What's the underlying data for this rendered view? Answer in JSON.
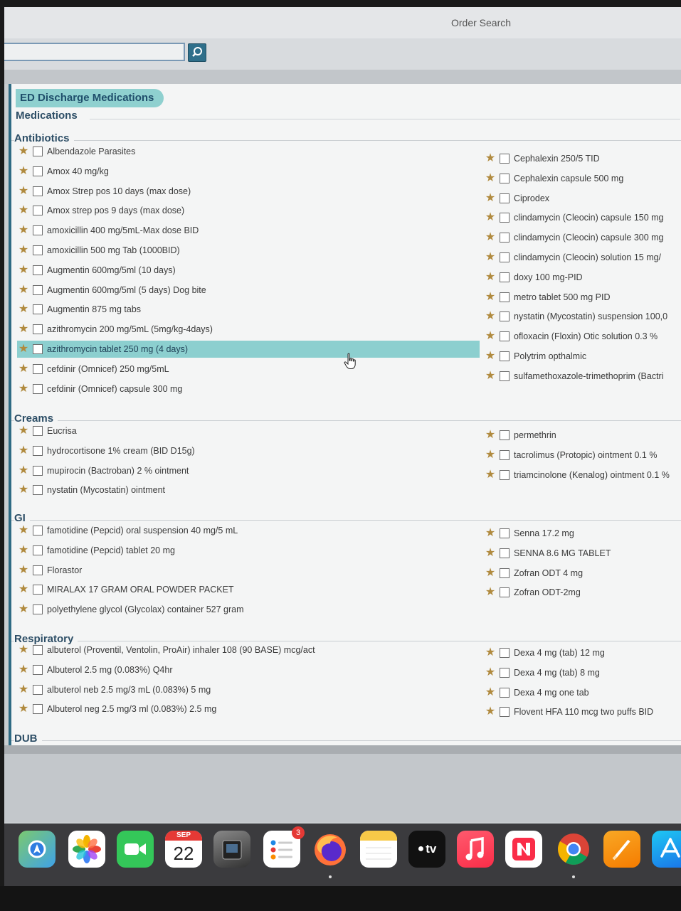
{
  "window": {
    "title": "Order Search"
  },
  "search": {
    "value": "",
    "placeholder": ""
  },
  "folder": {
    "title": "ED Discharge Medications",
    "subtitle": "Medications"
  },
  "categories": {
    "antibiotics": {
      "label": "Antibiotics",
      "left": [
        "Albendazole Parasites",
        "Amox 40 mg/kg",
        "Amox Strep pos 10 days (max dose)",
        "Amox strep pos 9 days (max dose)",
        "amoxicillin 400 mg/5mL-Max dose BID",
        "amoxicillin 500 mg Tab (1000BID)",
        "Augmentin 600mg/5ml (10 days)",
        "Augmentin 600mg/5ml (5 days) Dog bite",
        "Augmentin 875 mg tabs",
        "azithromycin 200 mg/5mL (5mg/kg-4days)",
        "azithromycin tablet 250 mg (4 days)",
        "cefdinir (Omnicef) 250 mg/5mL",
        "cefdinir (Omnicef) capsule 300 mg"
      ],
      "right": [
        "Cephalexin 250/5 TID",
        "Cephalexin capsule 500 mg",
        "Ciprodex",
        "clindamycin (Cleocin) capsule 150 mg",
        "clindamycin (Cleocin) capsule 300 mg",
        "clindamycin (Cleocin) solution 15 mg/",
        "doxy 100 mg-PID",
        "metro tablet 500 mg PID",
        "nystatin (Mycostatin) suspension 100,0",
        "ofloxacin (Floxin) Otic solution 0.3 %",
        "Polytrim opthalmic",
        "sulfamethoxazole-trimethoprim (Bactri"
      ]
    },
    "creams": {
      "label": "Creams",
      "left": [
        "Eucrisa",
        "hydrocortisone 1% cream (BID D15g)",
        "mupirocin (Bactroban) 2 % ointment",
        "nystatin (Mycostatin) ointment"
      ],
      "right": [
        "permethrin",
        "tacrolimus (Protopic) ointment 0.1 %",
        "triamcinolone (Kenalog) ointment 0.1 %"
      ]
    },
    "gi": {
      "label": "GI",
      "left": [
        "famotidine (Pepcid) oral suspension 40 mg/5 mL",
        "famotidine (Pepcid) tablet 20 mg",
        "Florastor",
        "MIRALAX 17 GRAM ORAL POWDER PACKET",
        "polyethylene glycol (Glycolax) container 527 gram"
      ],
      "right": [
        "Senna 17.2 mg",
        "SENNA 8.6 MG TABLET",
        "Zofran ODT 4 mg",
        "Zofran ODT-2mg"
      ]
    },
    "respiratory": {
      "label": "Respiratory",
      "left": [
        "albuterol (Proventil, Ventolin, ProAir) inhaler 108 (90 BASE) mcg/act",
        "Albuterol 2.5 mg (0.083%) Q4hr",
        "albuterol neb 2.5 mg/3 mL (0.083%) 5 mg",
        "Albuterol neg 2.5 mg/3 ml (0.083%) 2.5 mg"
      ],
      "right": [
        "Dexa 4 mg (tab) 12 mg",
        "Dexa 4 mg (tab) 8 mg",
        "Dexa 4 mg one tab",
        "Flovent HFA 110 mcg two puffs BID"
      ]
    },
    "dub": {
      "label": "DUB"
    }
  },
  "icons": {
    "favorite": "star-icon",
    "search": "search-icon",
    "cursor": "hand-pointer-icon"
  },
  "dock": {
    "calendar_month": "SEP",
    "calendar_day": "22",
    "reminders_badge": "3",
    "tv_label": "tv"
  },
  "colors": {
    "accent": "#8fd0cf",
    "selection": "#8ccfcf",
    "star": "#b08a3e",
    "panel_border": "#2f6b84"
  }
}
